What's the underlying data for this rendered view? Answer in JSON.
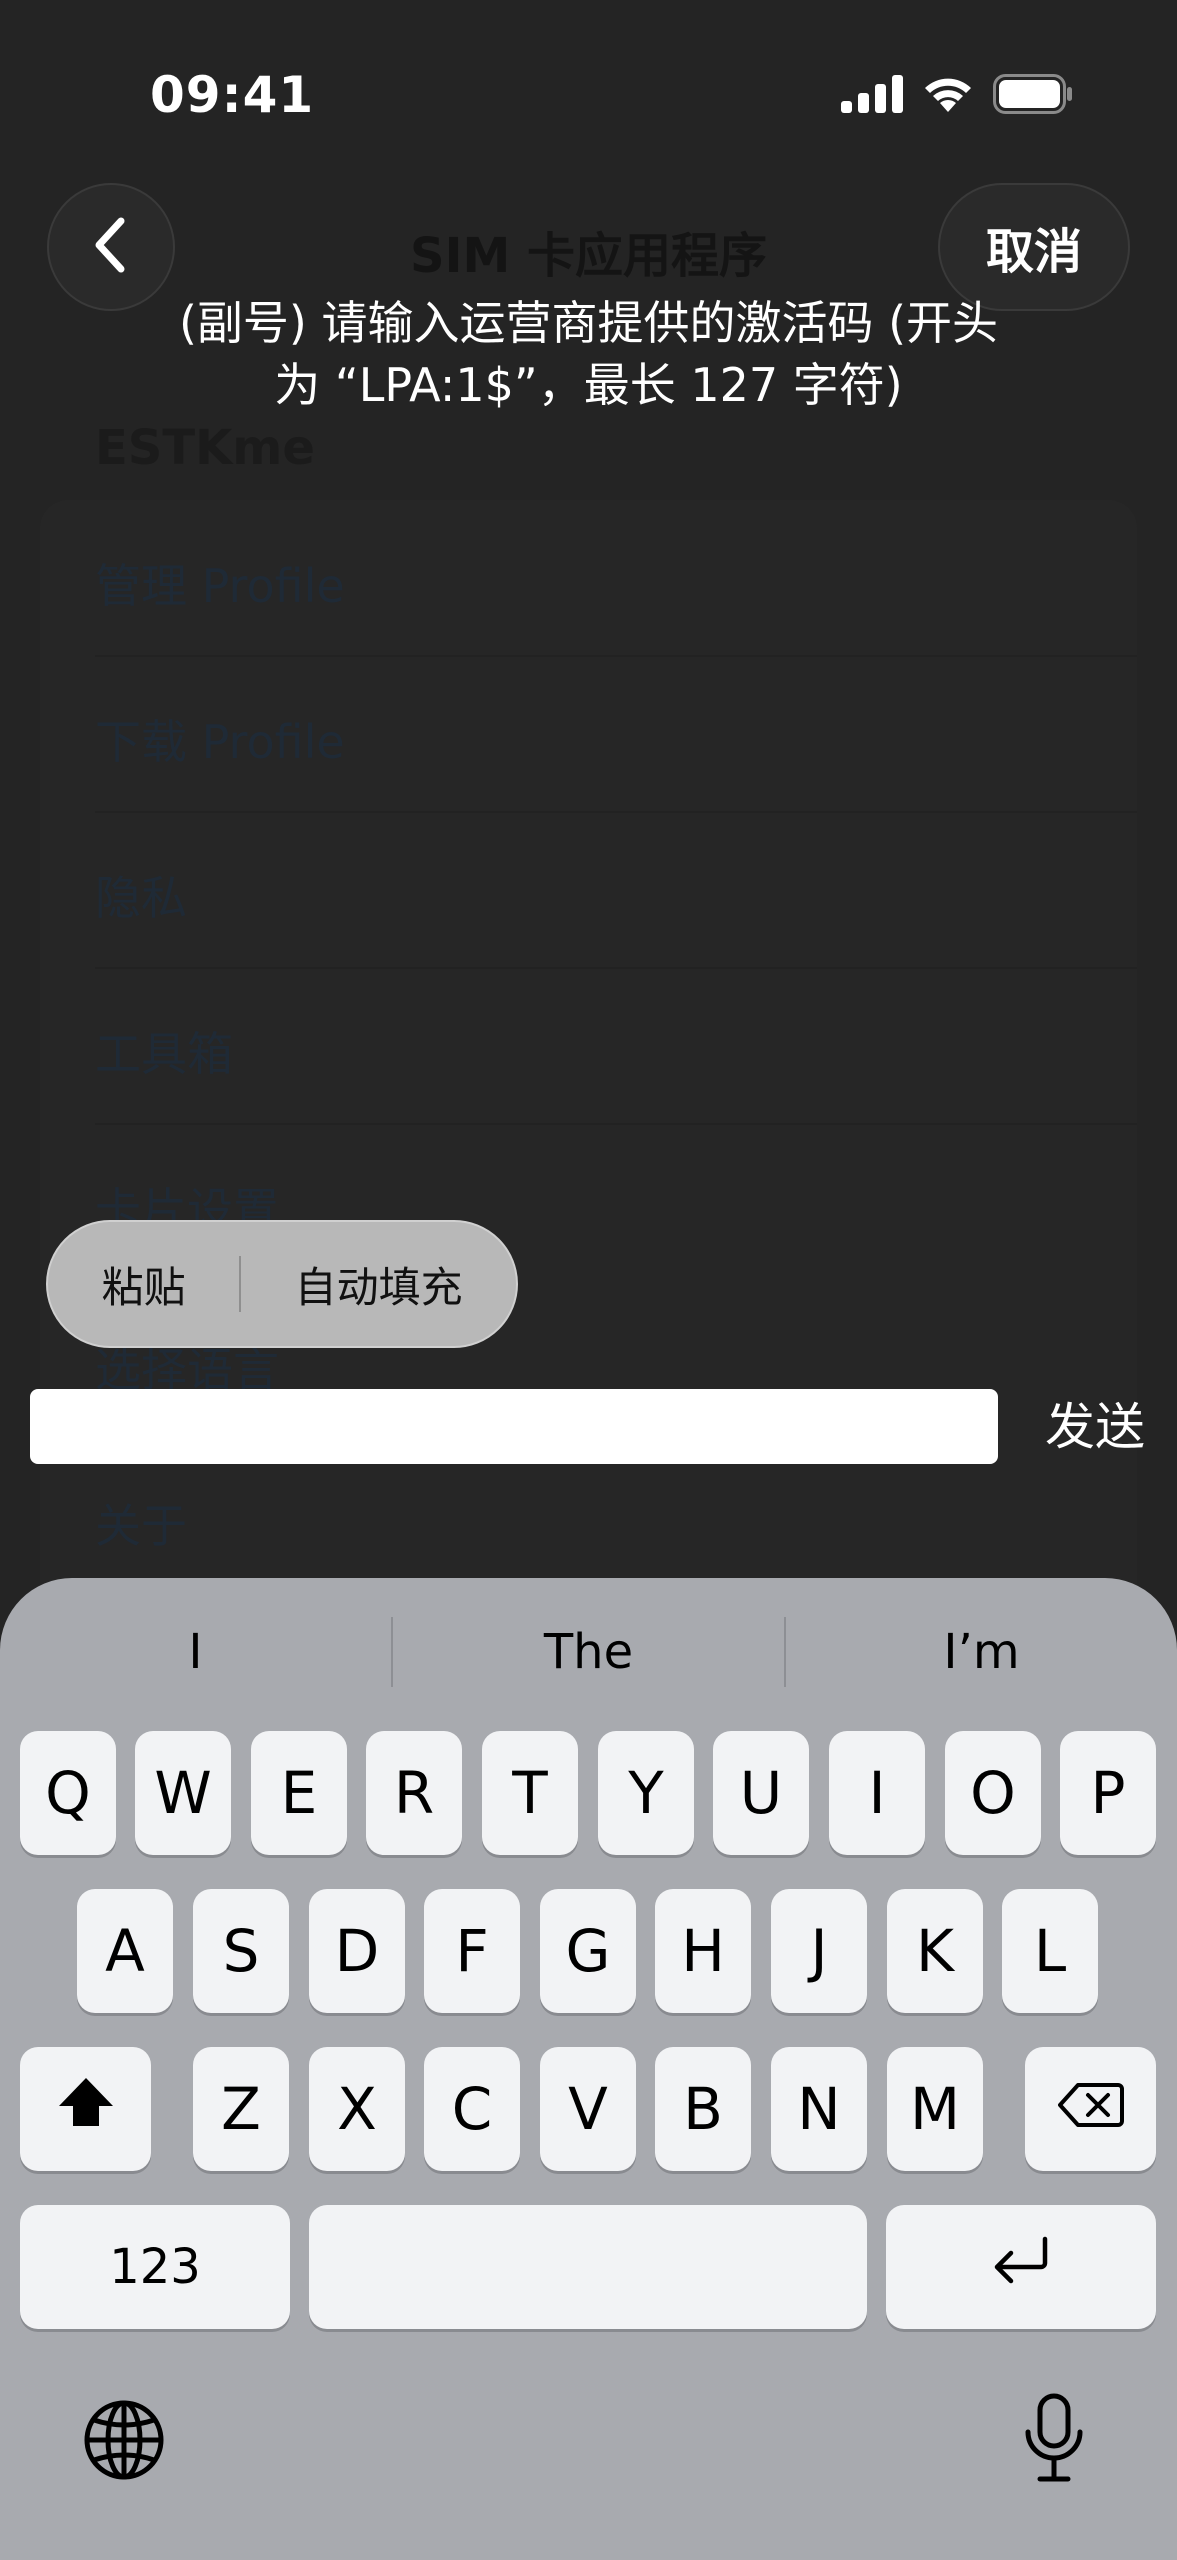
{
  "status_bar": {
    "time": "09:41"
  },
  "background": {
    "title": "SIM 卡应用程序",
    "section": "ESTKme",
    "items": [
      "管理 Profile",
      "下载 Profile",
      "隐私",
      "工具箱",
      "卡片设置",
      "选择语言",
      "关于"
    ]
  },
  "nav": {
    "back_icon": "chevron-left-icon",
    "cancel_label": "取消"
  },
  "prompt": {
    "line1": "(副号) 请输入运营商提供的激活码 (开头",
    "line2": "为 “LPA:1$”，最长 127 字符)"
  },
  "edit_menu": {
    "paste": "粘贴",
    "autofill": "自动填充"
  },
  "input": {
    "value": "",
    "placeholder": ""
  },
  "send_label": "发送",
  "keyboard": {
    "predictions": [
      "I",
      "The",
      "I’m"
    ],
    "row1": [
      "Q",
      "W",
      "E",
      "R",
      "T",
      "Y",
      "U",
      "I",
      "O",
      "P"
    ],
    "row2": [
      "A",
      "S",
      "D",
      "F",
      "G",
      "H",
      "J",
      "K",
      "L"
    ],
    "row3": [
      "Z",
      "X",
      "C",
      "V",
      "B",
      "N",
      "M"
    ],
    "numbers_label": "123",
    "icons": [
      "shift-icon",
      "backspace-icon",
      "return-icon",
      "globe-icon",
      "microphone-icon"
    ]
  }
}
